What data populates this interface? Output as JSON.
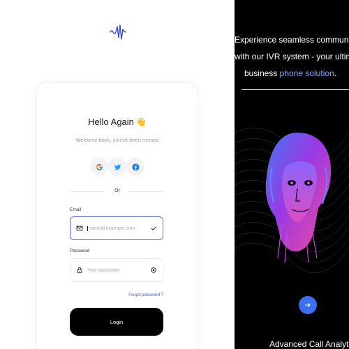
{
  "logo": {
    "icon": "waveform-logo-icon"
  },
  "login": {
    "title": "Hello Again",
    "title_emoji": "👋",
    "subtitle": "Welcome back, you've been missed",
    "social": [
      {
        "name": "google",
        "icon": "google-icon"
      },
      {
        "name": "twitter",
        "icon": "twitter-icon"
      },
      {
        "name": "facebook",
        "icon": "facebook-icon"
      }
    ],
    "or_text": "Or",
    "email": {
      "label": "Email",
      "placeholder": "name@example.com",
      "value": ""
    },
    "password": {
      "label": "Password",
      "placeholder": "Your password",
      "value": ""
    },
    "forgot_label": "Forgot password ?",
    "login_label": "Login"
  },
  "promo": {
    "line1": "Experience seamless communic",
    "line2": "with our IVR system - your ultim",
    "line3_prefix": "business ",
    "line3_accent": "phone solution",
    "line3_suffix": ".",
    "caption": "Advanced Call Analytics"
  },
  "colors": {
    "accent_blue": "#3b6ff0",
    "link_blue": "#3a5fd6",
    "input_focus": "#5b6fd8",
    "right_bg": "#000000",
    "highlight_text": "#8ea2ff"
  }
}
